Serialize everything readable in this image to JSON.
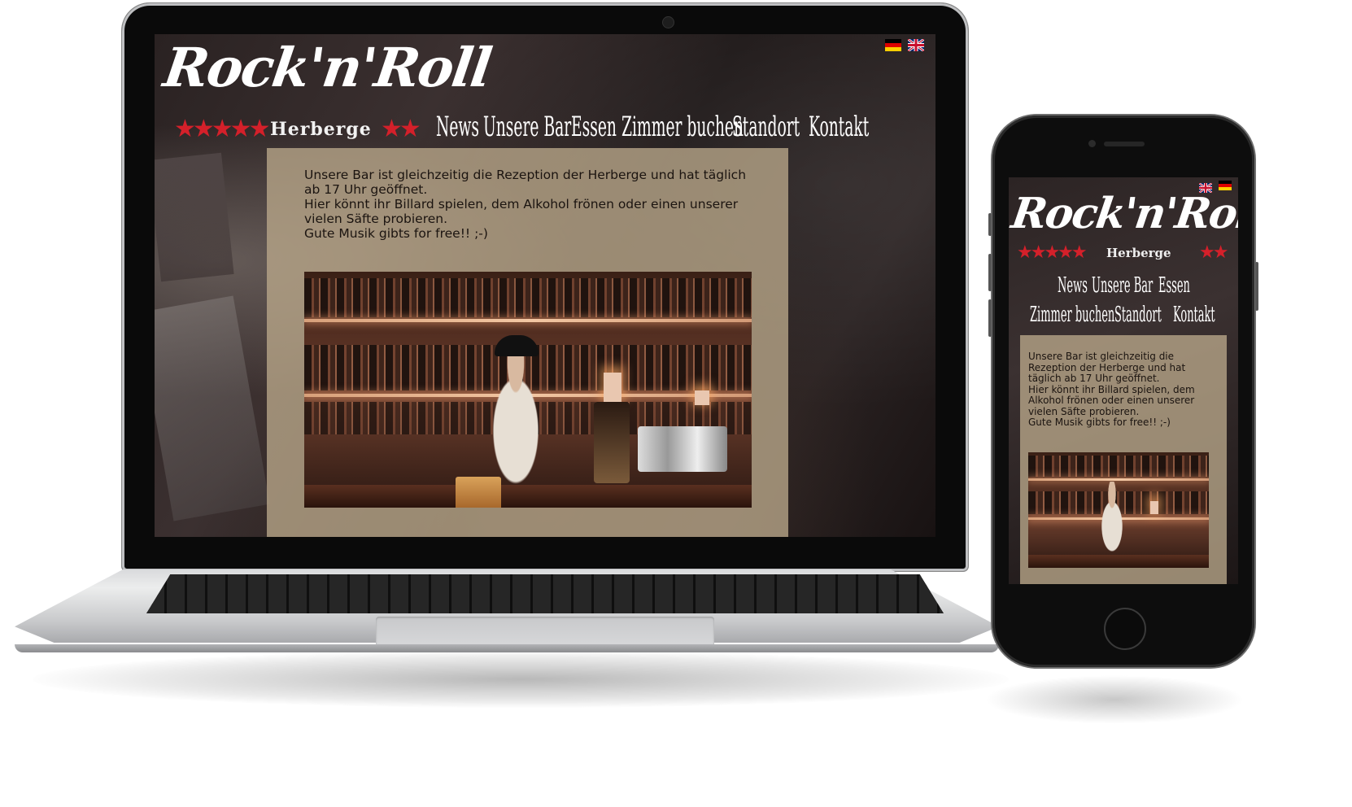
{
  "site": {
    "logo_main": "Rock'n'Roll",
    "logo_sub": "Herberge",
    "logo_stars_left": "★★★★★",
    "logo_stars_right": "★★",
    "nav": [
      "News",
      "Unsere Bar",
      "Essen",
      "Zimmer buchen",
      "Standort",
      "Kontakt"
    ],
    "languages": [
      "Deutsch",
      "English"
    ],
    "content": {
      "line1": "Unsere Bar ist gleichzeitig die Rezeption der Herberge und hat täglich ab 17 Uhr geöffnet.",
      "line2": "Hier könnt ihr Billard spielen, dem Alkohol frönen oder einen unserer vielen Säfte probieren.",
      "line3": "Gute Musik gibts for free!! ;-)"
    },
    "photo_alt": "bar-photo"
  },
  "colors": {
    "accent_red": "#d4202a",
    "content_panel": "#baa88b",
    "nav_text": "#ffffff"
  },
  "icons": {
    "flag_de": "germany-flag-icon",
    "flag_uk": "uk-flag-icon"
  }
}
